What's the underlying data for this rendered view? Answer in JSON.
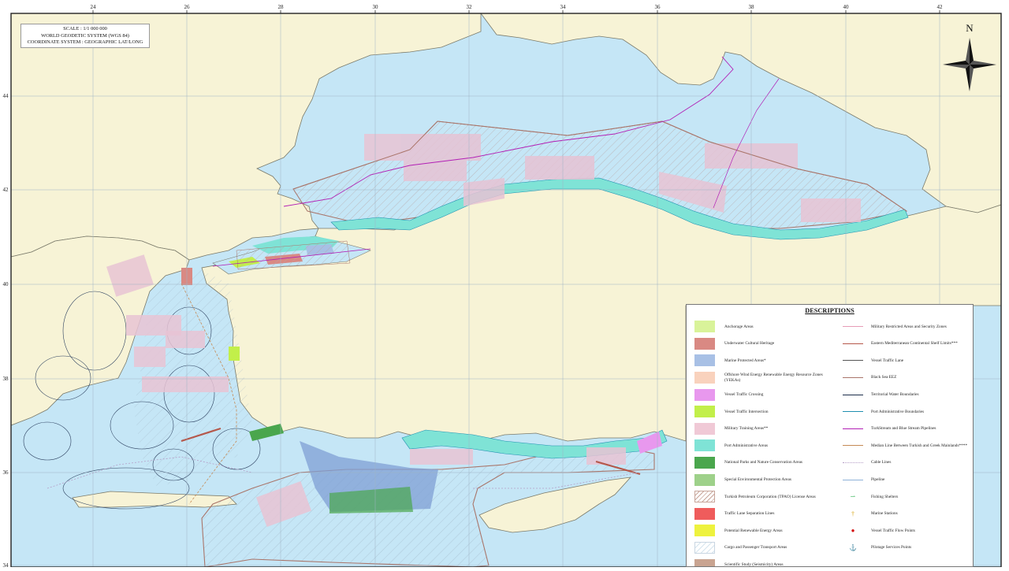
{
  "scale_box": {
    "line1": "SCALE : 1/1 000 000",
    "line2": "WORLD GEODETIC SYSTEM (WGS 84)",
    "line3": "COORDINATE SYSTEM : GEOGRAPHIC LAT/LONG"
  },
  "north_arrow": {
    "label": "N",
    "icon": "compass-rose-icon"
  },
  "longitude_ticks": [
    "24",
    "26",
    "28",
    "30",
    "32",
    "34",
    "36",
    "38",
    "40",
    "42"
  ],
  "latitude_ticks": [
    "44",
    "42",
    "40",
    "38",
    "36",
    "34"
  ],
  "colors": {
    "sea": "#c5e6f6",
    "land": "#f7f3d6",
    "military": "#e7c3d4",
    "port_admin": "#7edfd8",
    "marine_protected": "#7f9fd4",
    "national_parks": "#4caf50",
    "tpao_hatch": "#c8a69b",
    "eez": "#a9756a"
  },
  "legend": {
    "title": "DESCRIPTIONS",
    "left_items": [
      {
        "label": "Anchorage Areas",
        "swatch": "#d9f39a",
        "kind": "fill"
      },
      {
        "label": "Underwater Cultural Heritage",
        "swatch": "#d98983",
        "kind": "fill"
      },
      {
        "label": "Marine Protected Areas*",
        "swatch": "#a8c0e5",
        "kind": "fill"
      },
      {
        "label": "Offshore Wind Energy Renewable Energy Resource Zones (YEKAs)",
        "swatch": "#f9d2bd",
        "kind": "fill"
      },
      {
        "label": "Vessel Traffic Crossing",
        "swatch": "#e898ee",
        "kind": "fill"
      },
      {
        "label": "Vessel Traffic Intersection",
        "swatch": "#c2ef4a",
        "kind": "fill"
      },
      {
        "label": "Military Training Areas**",
        "swatch": "#f0c9d6",
        "kind": "fill"
      },
      {
        "label": "Port Administrative Areas",
        "swatch": "#7fe3d6",
        "kind": "fill"
      },
      {
        "label": "National Parks and Nature Conservation Areas",
        "swatch": "#4aa64d",
        "kind": "fill"
      },
      {
        "label": "Special Environmental Protection Areas",
        "swatch": "#9ed18a",
        "kind": "fill"
      },
      {
        "label": "Turkish Petroleum Corporation (TPAO) License Areas",
        "swatch": "",
        "kind": "hatch"
      },
      {
        "label": "Traffic Lane Separation Lines",
        "swatch": "#ef5c5c",
        "kind": "fill"
      },
      {
        "label": "Potential Renewable Energy Areas",
        "swatch": "#eef23e",
        "kind": "fill"
      },
      {
        "label": "Cargo and Passenger Transport Areas",
        "swatch": "",
        "kind": "blank"
      },
      {
        "label": "Scientific Study (Seismicity) Areas",
        "swatch": "#c9a491",
        "kind": "fill"
      }
    ],
    "right_items": [
      {
        "label": "Military Restricted Areas and Security Zones",
        "color": "#e79bb7",
        "kind": "line"
      },
      {
        "label": "Eastern Mediterranean Continental Shelf Limits***",
        "color": "#b5584b",
        "kind": "line"
      },
      {
        "label": "Vessel Traffic Lane",
        "color": "#555555",
        "kind": "line"
      },
      {
        "label": "Black Sea EEZ",
        "color": "#a9756a",
        "kind": "line"
      },
      {
        "label": "Territorial Water Boundaries",
        "color": "#1b2d4a",
        "kind": "line"
      },
      {
        "label": "Port Administrative Boundaries",
        "color": "#1f8fb0",
        "kind": "line"
      },
      {
        "label": "TurkStream and Blue Stream Pipelines",
        "color": "#b21fb5",
        "kind": "line"
      },
      {
        "label": "Median Line Between Turkish and Greek Mainlands****",
        "color": "#c58a55",
        "kind": "line"
      },
      {
        "label": "Cable Lines",
        "color": "#b59ec7",
        "kind": "dotted"
      },
      {
        "label": "Pipeline",
        "color": "#8fb2d9",
        "kind": "line"
      },
      {
        "label": "Fishing Shelters",
        "color": "#3bb55b",
        "kind": "point",
        "glyph": "⇀"
      },
      {
        "label": "Marine Stations",
        "color": "#d5a20f",
        "kind": "point",
        "glyph": "†"
      },
      {
        "label": "Vessel Traffic Flow Points",
        "color": "#d40d0d",
        "kind": "point",
        "glyph": "●"
      },
      {
        "label": "Pilotage Services Points",
        "color": "#56b7e6",
        "kind": "point",
        "glyph": "⚓"
      }
    ]
  }
}
